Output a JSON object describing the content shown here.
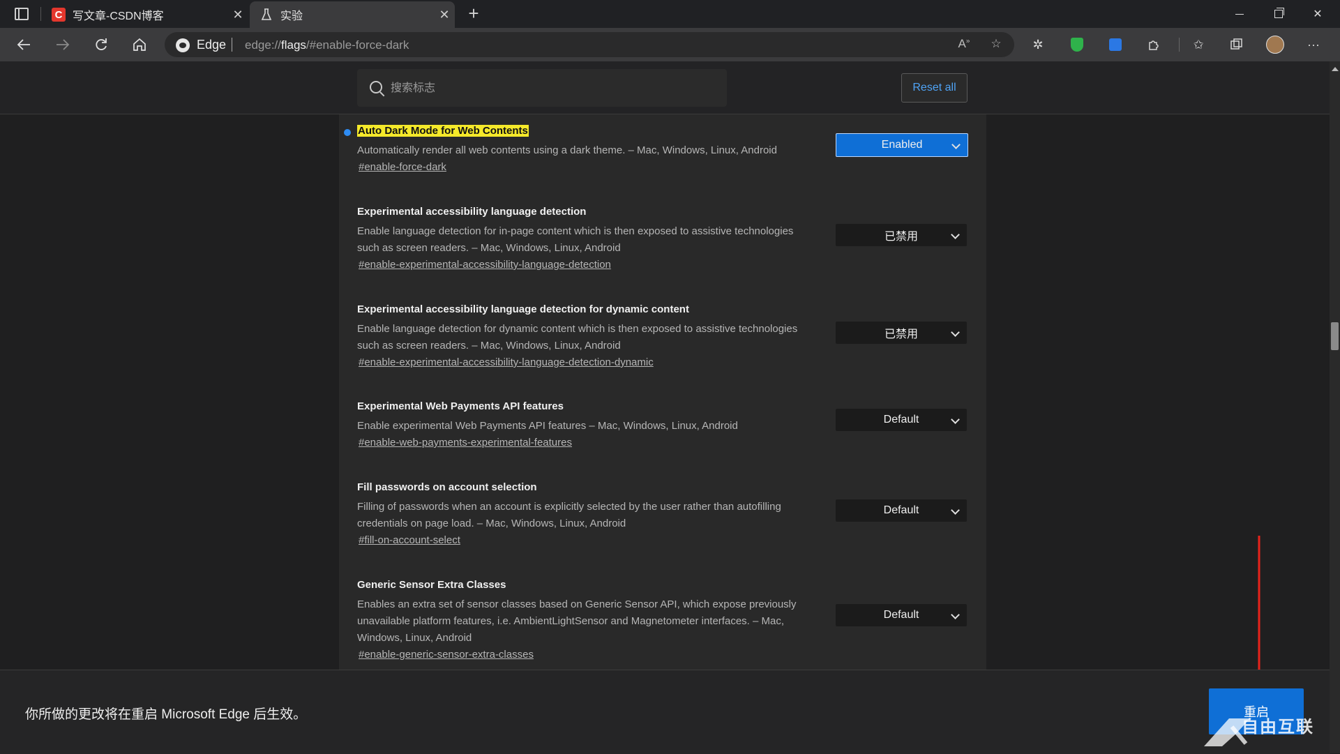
{
  "tabs": [
    {
      "title": "写文章-CSDN博客",
      "favicon": "csdn-icon",
      "active": false
    },
    {
      "title": "实验",
      "favicon": "flask-icon",
      "active": true
    }
  ],
  "address_bar": {
    "brand": "Edge",
    "url_prefix": "edge://",
    "url_host": "flags",
    "url_suffix": "/#enable-force-dark"
  },
  "search": {
    "placeholder": "搜索标志",
    "value": ""
  },
  "reset_all_label": "Reset all",
  "flags": [
    {
      "title": "Auto Dark Mode for Web Contents",
      "description": "Automatically render all web contents using a dark theme. – Mac, Windows, Linux, Android",
      "link": "#enable-force-dark",
      "state": "Enabled",
      "highlighted": true
    },
    {
      "title": "Experimental accessibility language detection",
      "description": "Enable language detection for in-page content which is then exposed to assistive technologies such as screen readers. – Mac, Windows, Linux, Android",
      "link": "#enable-experimental-accessibility-language-detection",
      "state": "已禁用"
    },
    {
      "title": "Experimental accessibility language detection for dynamic content",
      "description": "Enable language detection for dynamic content which is then exposed to assistive technologies such as screen readers. – Mac, Windows, Linux, Android",
      "link": "#enable-experimental-accessibility-language-detection-dynamic",
      "state": "已禁用"
    },
    {
      "title": "Experimental Web Payments API features",
      "description": "Enable experimental Web Payments API features – Mac, Windows, Linux, Android",
      "link": "#enable-web-payments-experimental-features",
      "state": "Default"
    },
    {
      "title": "Fill passwords on account selection",
      "description": "Filling of passwords when an account is explicitly selected by the user rather than autofilling credentials on page load. – Mac, Windows, Linux, Android",
      "link": "#fill-on-account-select",
      "state": "Default"
    },
    {
      "title": "Generic Sensor Extra Classes",
      "description": "Enables an extra set of sensor classes based on Generic Sensor API, which expose previously unavailable platform features, i.e. AmbientLightSensor and Magnetometer interfaces. – Mac, Windows, Linux, Android",
      "link": "#enable-generic-sensor-extra-classes",
      "state": "Default"
    }
  ],
  "restart_bar": {
    "message": "你所做的更改将在重启 Microsoft Edge 后生效。",
    "button": "重启"
  },
  "watermark": "自由互联",
  "colors": {
    "accent": "#0f6fd6",
    "highlight": "#f5e92a",
    "annotation_arrow": "#e8231b"
  }
}
